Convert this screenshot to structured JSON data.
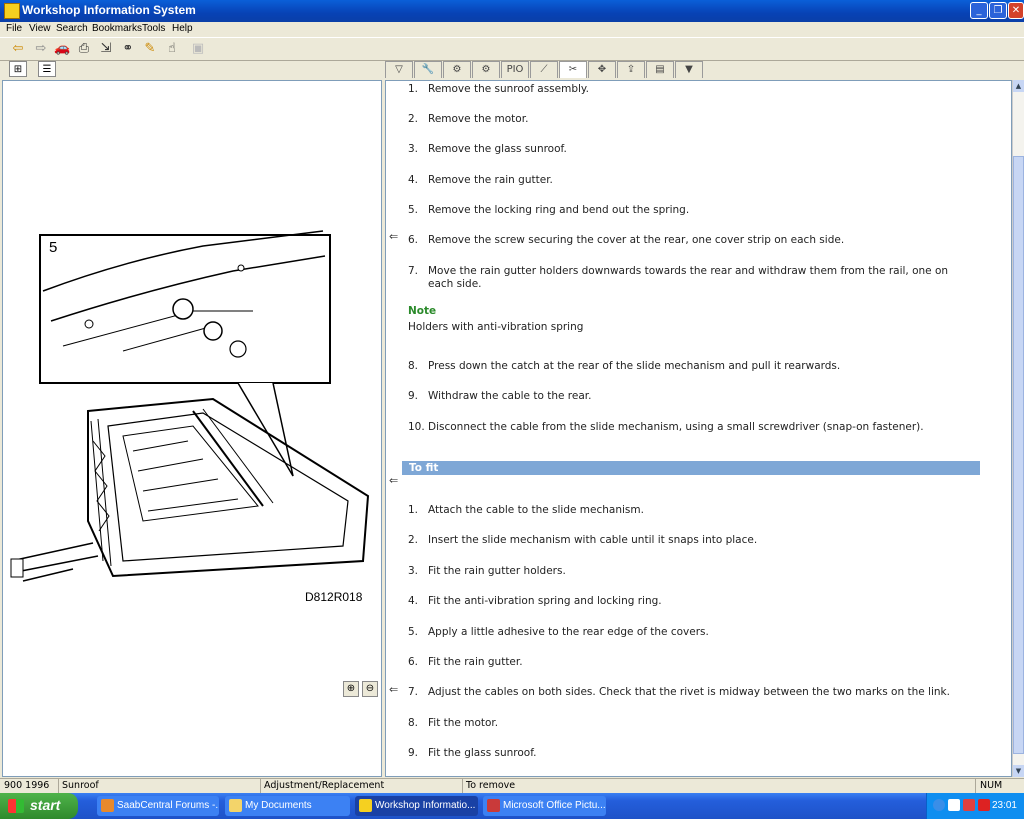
{
  "window": {
    "title": "Workshop Information System"
  },
  "menu": [
    "File",
    "View",
    "Search",
    "Bookmarks",
    "Tools",
    "Help"
  ],
  "illustration": {
    "callout": "5",
    "code": "D812R018"
  },
  "steps_remove": [
    {
      "num": "1.",
      "text": "Remove the sunroof assembly."
    },
    {
      "num": "2.",
      "text": "Remove the motor."
    },
    {
      "num": "3.",
      "text": "Remove the glass sunroof."
    },
    {
      "num": "4.",
      "text": "Remove the rain gutter."
    },
    {
      "num": "5.",
      "text": "Remove the locking ring and bend out the spring."
    },
    {
      "num": "6.",
      "text": "Remove the screw securing the cover at the rear, one cover strip on each side."
    },
    {
      "num": "7.",
      "text": "Move the rain gutter holders downwards towards the rear and withdraw them from the rail, one on each side."
    }
  ],
  "note": {
    "heading": "Note",
    "text": "Holders with anti-vibration spring"
  },
  "steps_remove2": [
    {
      "num": "8.",
      "text": "Press down the catch at the rear of the slide mechanism and pull it rearwards."
    },
    {
      "num": "9.",
      "text": "Withdraw the cable to the rear."
    },
    {
      "num": "10.",
      "text": "Disconnect the cable from the slide mechanism, using a small screwdriver (snap-on fastener)."
    }
  ],
  "to_fit_heading": "To fit",
  "steps_fit": [
    {
      "num": "1.",
      "text": "Attach the cable to the slide mechanism."
    },
    {
      "num": "2.",
      "text": "Insert the slide mechanism with cable until it snaps into place."
    },
    {
      "num": "3.",
      "text": "Fit the rain gutter holders."
    },
    {
      "num": "4.",
      "text": "Fit the anti-vibration spring and locking ring."
    },
    {
      "num": "5.",
      "text": "Apply a little adhesive to the rear edge of the covers."
    },
    {
      "num": "6.",
      "text": "Fit the rain gutter."
    },
    {
      "num": "7.",
      "text": "Adjust the cables on both sides. Check that the rivet is midway between the two marks on the link."
    },
    {
      "num": "8.",
      "text": "Fit the motor."
    },
    {
      "num": "9.",
      "text": "Fit the glass sunroof."
    }
  ],
  "status": {
    "model": "900 1996",
    "section": "Sunroof",
    "type": "Adjustment/Replacement",
    "action": "To remove",
    "num": "NUM"
  },
  "taskbar": {
    "start": "start",
    "tasks": [
      "SaabCentral Forums -...",
      "My Documents",
      "Workshop Informatio...",
      "Microsoft Office Pictu..."
    ],
    "clock": "23:01"
  }
}
